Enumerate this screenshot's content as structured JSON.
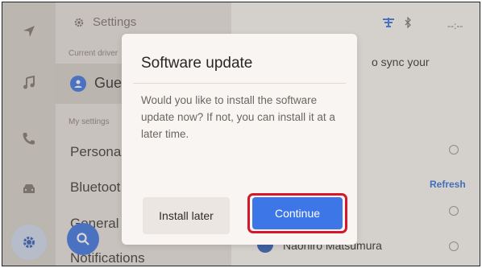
{
  "settings": {
    "title": "Settings"
  },
  "driver": {
    "section_label": "Current driver",
    "name": "Gue"
  },
  "my_settings": {
    "section_label": "My settings"
  },
  "menu": [
    "Personal",
    "Bluetoot",
    "General",
    "Notifications"
  ],
  "status": {
    "time": "--:--"
  },
  "content": {
    "sync_text": "o sync your",
    "refresh_label": "Refresh",
    "name": "Naohiro Matsumura"
  },
  "dialog": {
    "title": "Software update",
    "body": "Would you like to install the software update now? If not, you can install it at a later time.",
    "secondary_label": "Install later",
    "primary_label": "Continue"
  },
  "colors": {
    "accent": "#3d76e6",
    "highlight": "#d6172a"
  },
  "icons": [
    "navigation-icon",
    "music-icon",
    "phone-icon",
    "car-icon",
    "gear-icon",
    "search-icon",
    "person-icon",
    "signal-icon",
    "bluetooth-icon"
  ]
}
